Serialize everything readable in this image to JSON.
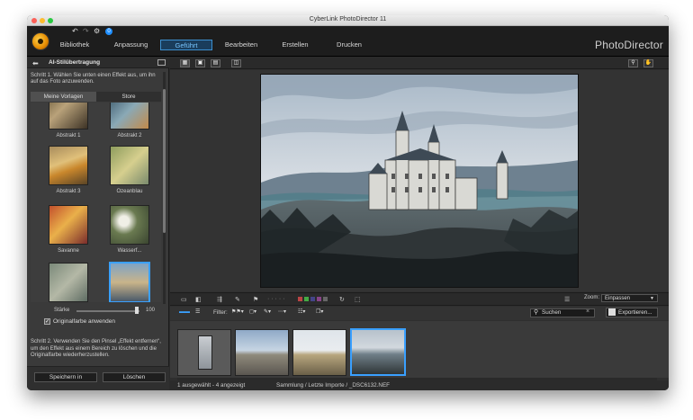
{
  "window": {
    "title": "CyberLink PhotoDirector 11"
  },
  "menu": {
    "tabs": [
      {
        "label": "Bibliothek"
      },
      {
        "label": "Anpassung"
      },
      {
        "label": "Geführt"
      },
      {
        "label": "Bearbeiten"
      },
      {
        "label": "Erstellen"
      },
      {
        "label": "Drucken"
      }
    ],
    "active_tab": "Geführt",
    "brand": "PhotoDirector",
    "quick_badge": "0"
  },
  "left_panel": {
    "title": "AI-Stilübertragung",
    "step1": "Schritt 1. Wählen Sie unten einen Effekt aus, um ihn auf das Foto anzuwenden.",
    "tabs": [
      {
        "label": "Meine Vorlagen"
      },
      {
        "label": "Store"
      }
    ],
    "presets": [
      {
        "label": "Abstrakt 1"
      },
      {
        "label": "Abstrakt 2"
      },
      {
        "label": "Abstrakt 3"
      },
      {
        "label": "Ozeanblau"
      },
      {
        "label": "Savanne"
      },
      {
        "label": "Wasserf..."
      },
      {
        "label": ""
      },
      {
        "label": ""
      }
    ],
    "strength_label": "Stärke",
    "strength_value": "100",
    "strength_level": 100,
    "original_color_label": "Originalfarbe anwenden",
    "original_color_checked": true,
    "step2": "Schritt 2. Verwenden Sie den Pinsel „Effekt entfernen“, um den Effekt aus einem Bereich zu löschen und die Originalfarbe wiederherzustellen.",
    "save_button": "Speichern in",
    "delete_button": "Löschen"
  },
  "viewer": {
    "zoom_label": "Zoom:",
    "zoom_value": "Einpassen"
  },
  "filter": {
    "label": "Filter:",
    "search_placeholder": "Suchen",
    "export_button": "Exportieren..."
  },
  "filmstrip": {
    "count": 4,
    "selected_index": 3
  },
  "status": {
    "selection": "1 ausgewählt - 4 angezeigt",
    "path": "Sammlung / Letzte Importe / _DSC6132.NEF"
  },
  "colors": {
    "accent": "#3aa0ff",
    "active_tab_text": "#79c6ff"
  }
}
